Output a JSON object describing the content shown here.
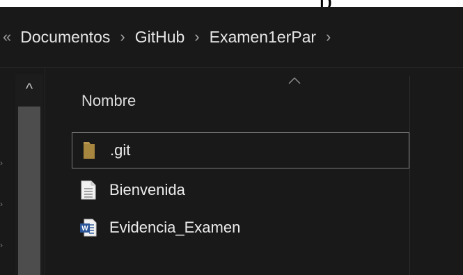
{
  "top_fragment": {
    "text": "p"
  },
  "breadcrumb": {
    "overflow_glyph": "«",
    "separator": "›",
    "items": [
      {
        "label": "Documentos"
      },
      {
        "label": "GitHub"
      },
      {
        "label": "Examen1erPar"
      }
    ]
  },
  "nav_pane": {
    "scroll_up_glyph": "^"
  },
  "file_list": {
    "column_header": "Nombre",
    "sort": "ascending",
    "items": [
      {
        "name": ".git",
        "icon": "folder-icon",
        "focused": true
      },
      {
        "name": "Bienvenida",
        "icon": "text-document-icon",
        "focused": false
      },
      {
        "name": "Evidencia_Examen",
        "icon": "word-document-icon",
        "focused": false
      }
    ]
  },
  "colors": {
    "background": "#191919",
    "folder": "#b8954f",
    "word_blue": "#2b579a",
    "focus_border": "#7d7d7d"
  }
}
